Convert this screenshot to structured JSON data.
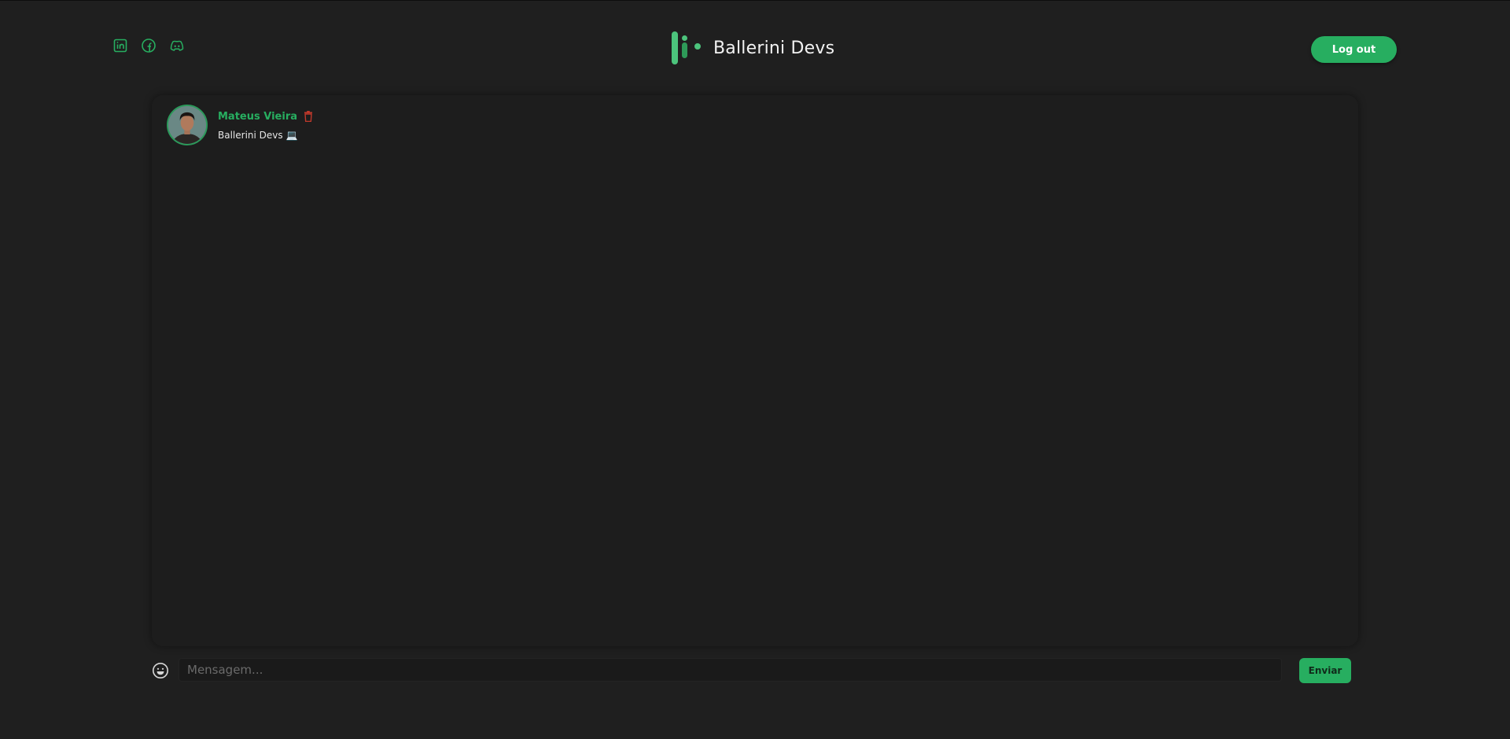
{
  "header": {
    "socials": [
      {
        "icon": "linkedin-icon"
      },
      {
        "icon": "facebook-icon"
      },
      {
        "icon": "discord-icon"
      }
    ],
    "brand_name": "Ballerini Devs",
    "logout_label": "Log out"
  },
  "chat": {
    "messages": [
      {
        "author": "Mateus Vieira",
        "text": "Ballerini Devs 💻",
        "delete_icon": "trash-icon"
      }
    ]
  },
  "composer": {
    "placeholder": "Mensagem...",
    "value": "",
    "send_label": "Enviar",
    "emoji_icon": "emoji-icon"
  },
  "colors": {
    "accent": "#27ae60",
    "background": "#1f1f1f",
    "panel": "#1d1d1d",
    "danger": "#c0392b"
  }
}
